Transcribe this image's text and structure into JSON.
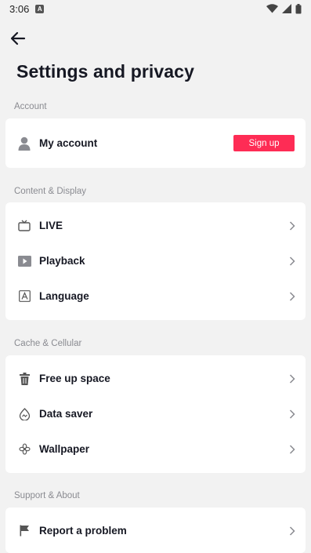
{
  "status_bar": {
    "time": "3:06",
    "notification_icon": "A"
  },
  "header": {
    "back_icon": "arrow-left-icon",
    "title": "Settings and privacy"
  },
  "sections": {
    "account": {
      "label": "Account",
      "my_account": {
        "label": "My account",
        "icon": "person-icon",
        "signup_label": "Sign up"
      }
    },
    "content_display": {
      "label": "Content & Display",
      "items": [
        {
          "label": "LIVE",
          "icon": "tv-icon"
        },
        {
          "label": "Playback",
          "icon": "play-icon"
        },
        {
          "label": "Language",
          "icon": "language-icon"
        }
      ]
    },
    "cache_cellular": {
      "label": "Cache & Cellular",
      "items": [
        {
          "label": "Free up space",
          "icon": "trash-icon"
        },
        {
          "label": "Data saver",
          "icon": "drop-icon"
        },
        {
          "label": "Wallpaper",
          "icon": "flower-icon"
        }
      ]
    },
    "support_about": {
      "label": "Support & About",
      "items": [
        {
          "label": "Report a problem",
          "icon": "flag-icon"
        }
      ]
    }
  },
  "colors": {
    "accent": "#fe2c55",
    "background": "#f2f2f2",
    "card": "#ffffff"
  }
}
